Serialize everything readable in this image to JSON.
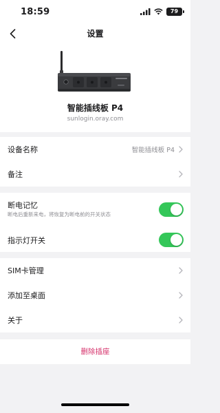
{
  "status_bar": {
    "time": "18:59",
    "battery": "79"
  },
  "nav": {
    "title": "设置"
  },
  "device": {
    "name": "智能插线板 P4",
    "domain": "sunlogin.oray.com"
  },
  "rows": {
    "device_name_label": "设备名称",
    "device_name_value": "智能插线板 P4",
    "note_label": "备注",
    "power_memory_label": "断电记忆",
    "power_memory_desc": "断电后重新来电，将恢复为断电前的开关状态",
    "power_memory_on": true,
    "indicator_label": "指示灯开关",
    "indicator_on": true,
    "sim_label": "SIM卡管理",
    "add_desktop_label": "添加至桌面",
    "about_label": "关于"
  },
  "actions": {
    "delete_label": "删除插座"
  },
  "colors": {
    "toggle_on": "#34c759",
    "danger": "#d6336c"
  }
}
